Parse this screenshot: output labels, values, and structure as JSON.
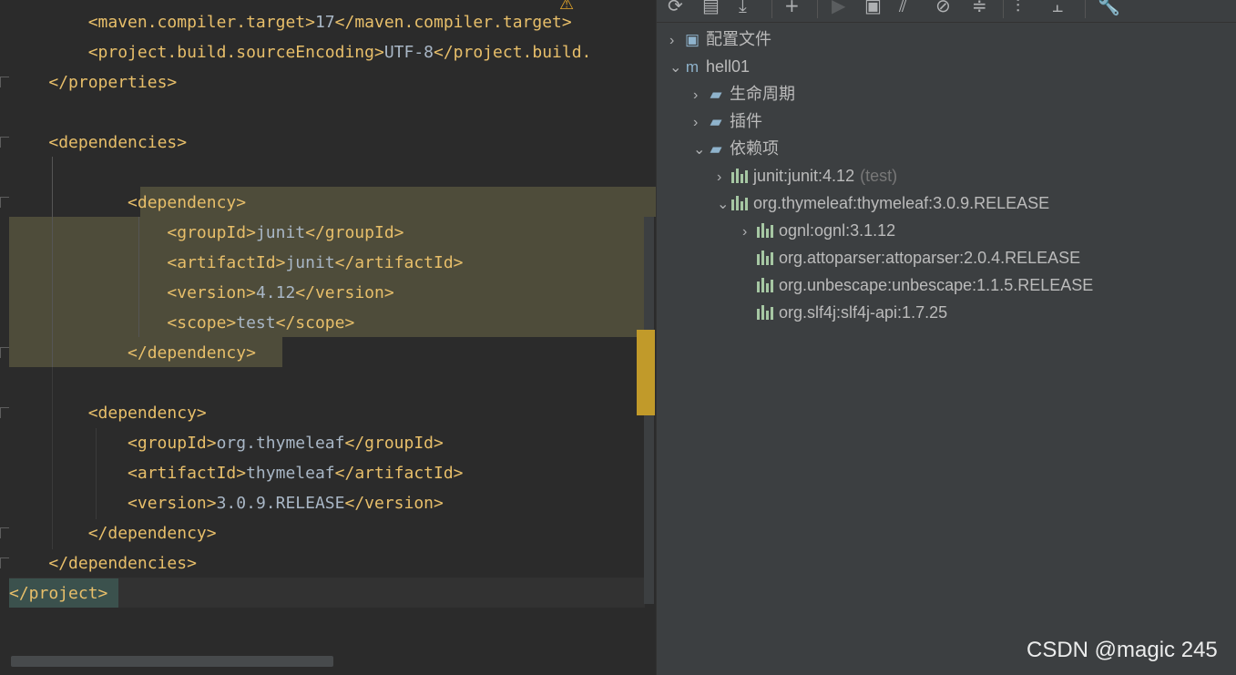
{
  "editor": {
    "lines": [
      {
        "indent": "        ",
        "open": "<maven.compiler.target>",
        "text": "17",
        "close": "</maven.compiler.target>"
      },
      {
        "indent": "        ",
        "open": "<project.build.sourceEncoding>",
        "text": "UTF-8",
        "close": "</project.build."
      },
      {
        "indent": "    ",
        "open": "</properties>",
        "text": "",
        "close": ""
      },
      {
        "indent": "",
        "open": "",
        "text": "",
        "close": ""
      },
      {
        "indent": "    ",
        "open": "<dependencies>",
        "text": "",
        "close": ""
      },
      {
        "indent": "",
        "open": "",
        "text": "",
        "close": ""
      },
      {
        "indent": "            ",
        "open": "<dependency>",
        "text": "",
        "close": ""
      },
      {
        "indent": "                ",
        "open": "<groupId>",
        "text": "junit",
        "close": "</groupId>"
      },
      {
        "indent": "                ",
        "open": "<artifactId>",
        "text": "junit",
        "close": "</artifactId>"
      },
      {
        "indent": "                ",
        "open": "<version>",
        "text": "4.12",
        "close": "</version>"
      },
      {
        "indent": "                ",
        "open": "<scope>",
        "text": "test",
        "close": "</scope>"
      },
      {
        "indent": "            ",
        "open": "</dependency>",
        "text": "",
        "close": ""
      },
      {
        "indent": "",
        "open": "",
        "text": "",
        "close": ""
      },
      {
        "indent": "        ",
        "open": "<dependency>",
        "text": "",
        "close": ""
      },
      {
        "indent": "            ",
        "open": "<groupId>",
        "text": "org.thymeleaf",
        "close": "</groupId>"
      },
      {
        "indent": "            ",
        "open": "<artifactId>",
        "text": "thymeleaf",
        "close": "</artifactId>"
      },
      {
        "indent": "            ",
        "open": "<version>",
        "text": "3.0.9.RELEASE",
        "close": "</version>"
      },
      {
        "indent": "        ",
        "open": "</dependency>",
        "text": "",
        "close": ""
      },
      {
        "indent": "    ",
        "open": "</dependencies>",
        "text": "",
        "close": ""
      },
      {
        "indent": "",
        "open": "</project>",
        "text": "",
        "close": ""
      }
    ]
  },
  "maven": {
    "tree": [
      {
        "label": "配置文件",
        "suffix": "",
        "chevron": "›",
        "icon": "profiles-icon",
        "glyph": "▣"
      },
      {
        "label": "hell01",
        "suffix": "",
        "chevron": "⌄",
        "icon": "maven-project-icon",
        "glyph": "m"
      },
      {
        "label": "生命周期",
        "suffix": "",
        "chevron": "›",
        "icon": "lifecycle-folder-icon",
        "glyph": "▰"
      },
      {
        "label": "插件",
        "suffix": "",
        "chevron": "›",
        "icon": "plugins-folder-icon",
        "glyph": "▰"
      },
      {
        "label": "依赖项",
        "suffix": "",
        "chevron": "⌄",
        "icon": "dependencies-folder-icon",
        "glyph": "▰"
      },
      {
        "label": "junit:junit:4.12",
        "suffix": "(test)",
        "chevron": "›",
        "icon": "dependency-icon",
        "glyph": ""
      },
      {
        "label": "org.thymeleaf:thymeleaf:3.0.9.RELEASE",
        "suffix": "",
        "chevron": "⌄",
        "icon": "dependency-icon",
        "glyph": ""
      },
      {
        "label": "ognl:ognl:3.1.12",
        "suffix": "",
        "chevron": "›",
        "icon": "dependency-icon",
        "glyph": ""
      },
      {
        "label": "org.attoparser:attoparser:2.0.4.RELEASE",
        "suffix": "",
        "chevron": "",
        "icon": "dependency-icon",
        "glyph": ""
      },
      {
        "label": "org.unbescape:unbescape:1.1.5.RELEASE",
        "suffix": "",
        "chevron": "",
        "icon": "dependency-icon",
        "glyph": ""
      },
      {
        "label": "org.slf4j:slf4j-api:1.7.25",
        "suffix": "",
        "chevron": "",
        "icon": "dependency-icon",
        "glyph": ""
      }
    ]
  },
  "watermark": "CSDN @magic 245"
}
